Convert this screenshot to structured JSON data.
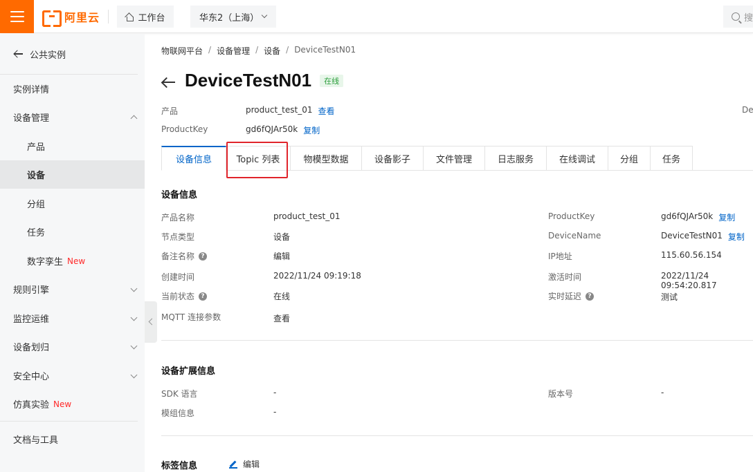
{
  "header": {
    "logo_text": "阿里云",
    "workbench_label": "工作台",
    "region_label": "华东2（上海）",
    "search_placeholder": "搜"
  },
  "sidebar": {
    "back_label": "公共实例",
    "items": [
      {
        "label": "实例详情"
      },
      {
        "label": "设备管理"
      },
      {
        "label": "产品"
      },
      {
        "label": "设备"
      },
      {
        "label": "分组"
      },
      {
        "label": "任务"
      },
      {
        "label": "数字孪生",
        "badge": "New"
      },
      {
        "label": "规则引擎"
      },
      {
        "label": "监控运维"
      },
      {
        "label": "设备划归"
      },
      {
        "label": "安全中心"
      },
      {
        "label": "仿真实验",
        "badge": "New"
      },
      {
        "label": "文档与工具"
      }
    ]
  },
  "breadcrumb": [
    "物联网平台",
    "设备管理",
    "设备",
    "DeviceTestN01"
  ],
  "device": {
    "title": "DeviceTestN01",
    "status": "在线",
    "product_label": "产品",
    "product_value": "product_test_01",
    "product_link": "查看",
    "productkey_label": "ProductKey",
    "productkey_value": "gd6fQJAr50k",
    "copy_label": "复制",
    "right_cut": "Dev"
  },
  "tabs": [
    "设备信息",
    "Topic 列表",
    "物模型数据",
    "设备影子",
    "文件管理",
    "日志服务",
    "在线调试",
    "分组",
    "任务"
  ],
  "device_info": {
    "title": "设备信息",
    "left": [
      {
        "label": "产品名称",
        "value": "product_test_01"
      },
      {
        "label": "节点类型",
        "value": "设备"
      },
      {
        "label": "备注名称",
        "value": "编辑"
      },
      {
        "label": "创建时间",
        "value": "2022/11/24 09:19:18"
      },
      {
        "label": "当前状态",
        "value": "在线"
      },
      {
        "label": "MQTT 连接参数",
        "value": "查看"
      }
    ],
    "right": [
      {
        "label": "ProductKey",
        "value": "gd6fQJAr50k",
        "link": "复制"
      },
      {
        "label": "DeviceName",
        "value": "DeviceTestN01",
        "link": "复制"
      },
      {
        "label": "IP地址",
        "value": "115.60.56.154"
      },
      {
        "label": "激活时间",
        "value": "2022/11/24 09:54:20.817"
      },
      {
        "label": "实时延迟",
        "value": "测试"
      }
    ]
  },
  "ext_info": {
    "title": "设备扩展信息",
    "sdk_label": "SDK 语言",
    "sdk_value": "-",
    "module_label": "模组信息",
    "module_value": "-",
    "version_label": "版本号",
    "version_value": "-"
  },
  "tag_info": {
    "title": "标签信息",
    "edit_label": "编辑"
  },
  "colors": {
    "accent_orange": "#ff6a00",
    "link_blue": "#0064c8",
    "highlight_red": "#e0242b",
    "online_green": "#2a9d3a"
  }
}
